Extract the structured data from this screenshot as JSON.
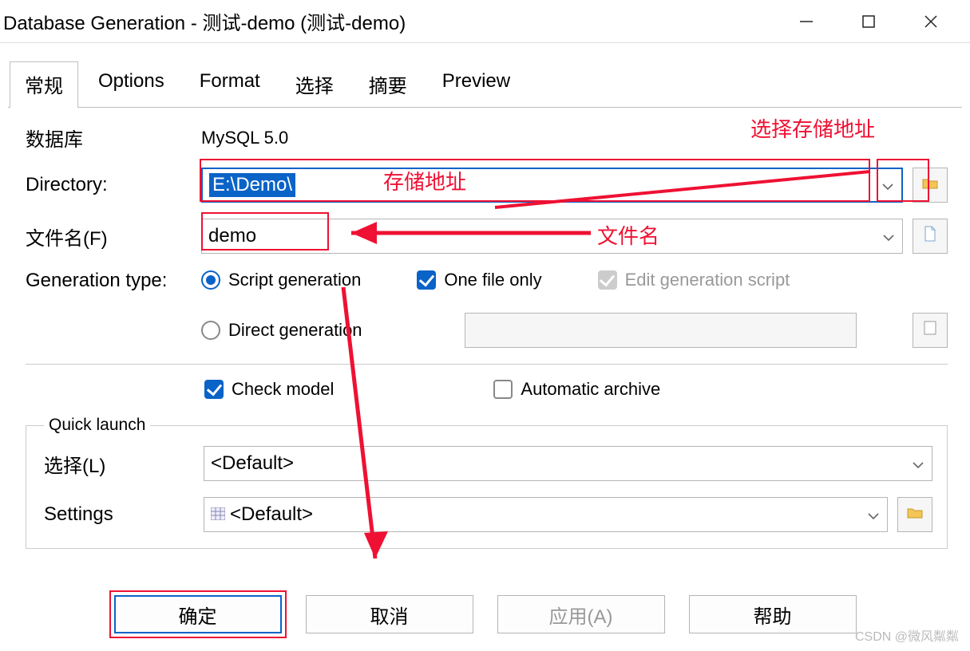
{
  "window": {
    "title": "Database Generation - 测试-demo (测试-demo)"
  },
  "tabs": [
    "常规",
    "Options",
    "Format",
    "选择",
    "摘要",
    "Preview"
  ],
  "labels": {
    "database": "数据库",
    "database_value": "MySQL 5.0",
    "directory": "Directory:",
    "filename": "文件名(F)",
    "generation_type": "Generation type:",
    "quick_launch": "Quick launch",
    "select": "选择(L)",
    "settings": "Settings"
  },
  "fields": {
    "directory_value": "E:\\Demo\\",
    "filename_value": "demo",
    "select_value": "<Default>",
    "settings_value": "<Default>"
  },
  "options": {
    "script_generation": "Script generation",
    "direct_generation": "Direct generation",
    "one_file_only": "One file only",
    "edit_generation_script": "Edit generation script",
    "check_model": "Check model",
    "automatic_archive": "Automatic archive"
  },
  "buttons": {
    "ok": "确定",
    "cancel": "取消",
    "apply": "应用(A)",
    "help": "帮助"
  },
  "annotations": {
    "storage_addr": "存储地址",
    "choose_storage": "选择存储地址",
    "filename": "文件名"
  },
  "watermark": "CSDN @微风粼粼"
}
